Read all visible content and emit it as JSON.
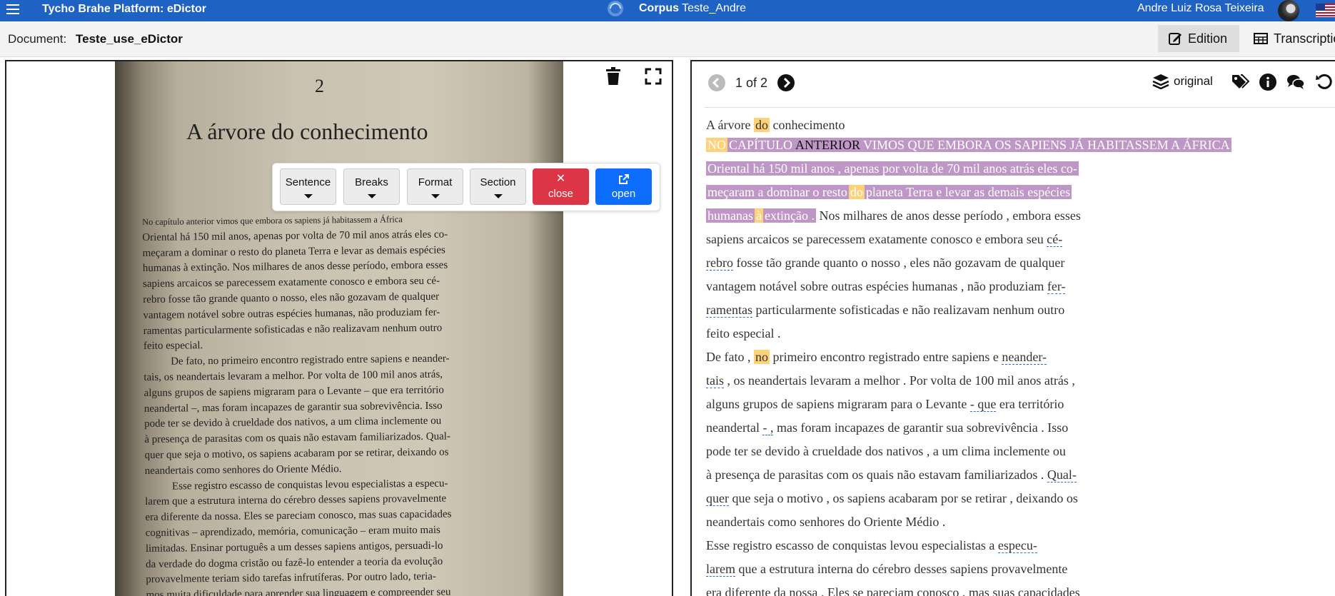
{
  "topbar": {
    "app_title": "Tycho Brahe Platform: eDictor",
    "corpus_label": "Corpus",
    "corpus_name": "Teste_Andre",
    "user_name": "Andre Luiz Rosa Teixeira"
  },
  "docbar": {
    "doc_label": "Document:",
    "doc_name": "Teste_use_eDictor",
    "tabs": [
      {
        "label": "Edition",
        "active": true
      },
      {
        "label": "Transcription",
        "active": false
      }
    ]
  },
  "scan": {
    "page_number": "2",
    "title": "A árvore do conhecimento",
    "lines": [
      "No capítulo anterior vimos que embora os sapiens já habitassem a África",
      "Oriental há 150 mil anos, apenas por volta de 70 mil anos atrás eles co-",
      "meçaram a dominar o resto do planeta Terra e levar as demais espécies",
      "humanas à extinção. Nos milhares de anos desse período, embora esses",
      "sapiens arcaicos se parecessem exatamente conosco e embora seu cé-",
      "rebro fosse tão grande quanto o nosso, eles não gozavam de qualquer",
      "vantagem notável sobre outras espécies humanas, não produziam fer-",
      "ramentas particularmente sofisticadas e não realizavam nenhum outro",
      "feito especial.",
      "De fato, no primeiro encontro registrado entre sapiens e neander-",
      "tais, os neandertais levaram a melhor. Por volta de 100 mil anos atrás,",
      "alguns grupos de sapiens migraram para o Levante – que era território",
      "neandertal –, mas foram incapazes de garantir sua sobrevivência. Isso",
      "pode ter se devido à crueldade dos nativos, a um clima inclemente ou",
      "à presença de parasitas com os quais não estavam familiarizados. Qual-",
      "quer que seja o motivo, os sapiens acabaram por se retirar, deixando os",
      "neandertais como senhores do Oriente Médio.",
      "Esse registro escasso de conquistas levou especialistas a especu-",
      "larem que a estrutura interna do cérebro desses sapiens provavelmente",
      "era diferente da nossa. Eles se pareciam conosco, mas suas capacidades",
      "cognitivas – aprendizado, memória, comunicação – eram muito mais",
      "limitadas. Ensinar português a um desses sapiens antigos, persuadi-lo",
      "da verdade do dogma cristão ou fazê-lo entender a teoria da evolução",
      "provavelmente teriam sido tarefas infrutíferas. Por outro lado, teria-",
      "mos muita dificuldade para aprender sua linguagem e compreender seu"
    ]
  },
  "toolbar": {
    "sentence": "Sentence",
    "breaks": "Breaks",
    "format": "Format",
    "section": "Section",
    "close": "close",
    "open": "open"
  },
  "edition": {
    "page_indicator": "1 of 2",
    "layer_label": "original",
    "title_line": {
      "a": "A árvore",
      "b": "do",
      "c": "conhecimento"
    },
    "l1": {
      "a": "NO",
      "b": "CAPÍTULO",
      "c": "ANTERIOR",
      "d": "VIMOS QUE EMBORA OS SAPIENS JÁ HABITASSEM A ÁFRICA"
    },
    "l2": "Oriental há 150 mil anos , apenas por volta de 70 mil anos atrás eles co-",
    "l3": {
      "a": "meçaram a dominar o resto",
      "b": "do",
      "c": "planeta Terra e levar as demais espécies"
    },
    "l4": {
      "a": "humanas",
      "b": "à",
      "c": "extinção .",
      "d": "Nos milhares de anos desse período , embora esses"
    },
    "l5": {
      "a": "sapiens arcaicos se parecessem exatamente conosco e embora seu",
      "b": "cé-"
    },
    "l6": {
      "a": "rebro",
      "b": "fosse tão grande quanto o nosso , eles não gozavam de qualquer"
    },
    "l7": {
      "a": "vantagem notável sobre outras espécies humanas , não produziam",
      "b": "fer-"
    },
    "l8": {
      "a": "ramentas",
      "b": "particularmente sofisticadas e não realizavam nenhum outro"
    },
    "l9": "feito especial .",
    "l10": {
      "a": "De fato ,",
      "b": "no",
      "c": "primeiro encontro registrado entre sapiens e",
      "d": "neander-"
    },
    "l11": {
      "a": "tais",
      "b": ", os neandertais levaram a melhor . Por volta de 100 mil anos atrás ,"
    },
    "l12": {
      "a": "alguns grupos de sapiens migraram para o Levante",
      "b": "- que",
      "c": "era território"
    },
    "l13": {
      "a": "neandertal",
      "b": "- ,",
      "c": "mas foram incapazes de garantir sua sobrevivência . Isso"
    },
    "l14": "pode ter se devido à crueldade dos nativos , a um clima inclemente ou",
    "l15": {
      "a": "à presença de parasitas com os quais não estavam familiarizados .",
      "b": "Qual-"
    },
    "l16": {
      "a": "quer",
      "b": "que seja o motivo , os sapiens acabaram por se retirar , deixando os"
    },
    "l17": "neandertais como senhores do Oriente Médio .",
    "l18": {
      "a": "Esse registro escasso de conquistas levou especialistas a",
      "b": "especu-"
    },
    "l19": {
      "a": "larem",
      "b": "que a estrutura interna do cérebro desses sapiens provavelmente"
    },
    "l20": "era diferente da nossa . Eles se pareciam conosco , mas suas capacidades"
  },
  "colors": {
    "topbar": "#1e63c4",
    "selection": "#bf97c7",
    "highlight": "#ffd27a",
    "close_button": "#dc3545",
    "open_button": "#0d6efd",
    "dashed_underline": "#2f6fd0"
  },
  "icons": [
    "menu-icon",
    "corpus-logo-icon",
    "avatar",
    "us-flag-icon",
    "edit-icon",
    "table-icon",
    "trash-icon",
    "fullscreen-icon",
    "close-icon",
    "external-link-icon",
    "prev-page-icon",
    "next-page-icon",
    "layers-icon",
    "tags-icon",
    "info-icon",
    "comments-icon",
    "undo-icon"
  ]
}
